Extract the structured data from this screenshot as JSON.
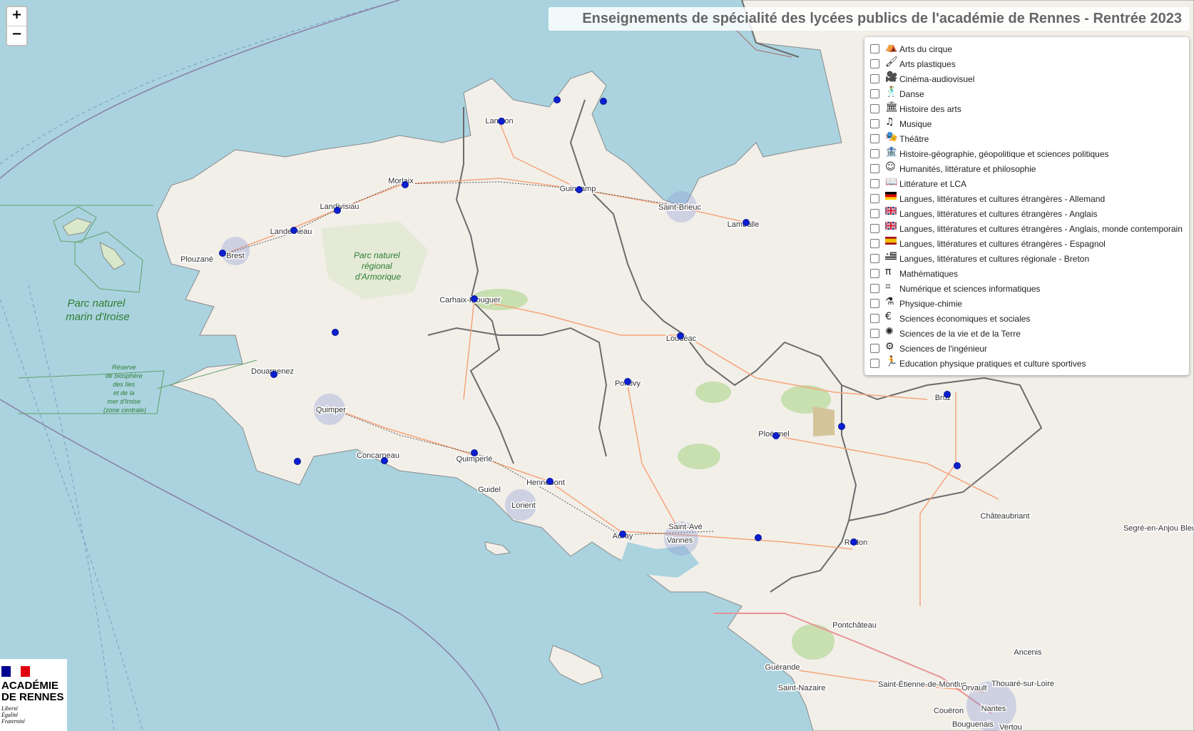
{
  "title": "Enseignements de spécialité des lycées publics de l'académie de Rennes - Rentrée 2023",
  "zoom": {
    "in": "+",
    "out": "−"
  },
  "colors": {
    "sea": "#aad3df",
    "land": "#f2efe9",
    "marker": "#0b1fd1",
    "boundary": "#6b6b6b"
  },
  "legend": [
    {
      "label": "Arts du cirque",
      "icon": "circus-tent-icon",
      "checked": false
    },
    {
      "label": "Arts plastiques",
      "icon": "paintbrush-icon",
      "checked": false
    },
    {
      "label": "Cinéma-audiovisuel",
      "icon": "video-camera-icon",
      "checked": false
    },
    {
      "label": "Danse",
      "icon": "dancer-icon",
      "checked": false
    },
    {
      "label": "Histoire des arts",
      "icon": "column-icon",
      "checked": false
    },
    {
      "label": "Musique",
      "icon": "music-note-icon",
      "checked": false
    },
    {
      "label": "Théâtre",
      "icon": "theater-curtain-icon",
      "checked": false
    },
    {
      "label": "Histoire-géographie, géopolitique et sciences politiques",
      "icon": "landmark-icon",
      "checked": false
    },
    {
      "label": "Humanités, littérature et philosophie",
      "icon": "head-profile-icon",
      "checked": false
    },
    {
      "label": "Littérature et LCA",
      "icon": "book-icon",
      "checked": false
    },
    {
      "label": "Langues, littératures et cultures étrangères - Allemand",
      "icon": "german-flag-icon",
      "checked": false
    },
    {
      "label": "Langues, littératures et cultures étrangères - Anglais",
      "icon": "uk-flag-icon",
      "checked": false
    },
    {
      "label": "Langues, littératures et cultures étrangères - Anglais, monde contemporain",
      "icon": "uk-flag-icon",
      "checked": false
    },
    {
      "label": "Langues, littératures et cultures étrangères - Espagnol",
      "icon": "spanish-flag-icon",
      "checked": false
    },
    {
      "label": "Langues, littératures et cultures régionale - Breton",
      "icon": "breton-flag-icon",
      "checked": false
    },
    {
      "label": "Mathématiques",
      "icon": "pi-icon",
      "checked": false
    },
    {
      "label": "Numérique et sciences informatiques",
      "icon": "binary-code-icon",
      "checked": false
    },
    {
      "label": "Physique-chimie",
      "icon": "flask-icon",
      "checked": false
    },
    {
      "label": "Sciences économiques et sociales",
      "icon": "euro-icon",
      "checked": false
    },
    {
      "label": "Sciences de la vie et de la Terre",
      "icon": "virus-icon",
      "checked": false
    },
    {
      "label": "Sciences de l'ingénieur",
      "icon": "gear-robot-icon",
      "checked": false
    },
    {
      "label": "Education physique pratiques et culture sportives",
      "icon": "runner-icon",
      "checked": false
    }
  ],
  "places": [
    "Lannion",
    "Morlaix",
    "Guingamp",
    "Saint-Brieuc",
    "Lamballe",
    "Landivisiau",
    "Landerneau",
    "Plouzané",
    "Brest",
    "Carhaix-Plouguer",
    "Loudéac",
    "Douarnenez",
    "Quimper",
    "Concarneau",
    "Quimperlé",
    "Pontivy",
    "Ploërmel",
    "Bruz",
    "Guidel",
    "Hennebont",
    "Lorient",
    "Auray",
    "Saint-Avé",
    "Vannes",
    "Redon",
    "Châteaubriant",
    "Segré-en-Anjou Bleu",
    "Pontchâteau",
    "Guérande",
    "Saint-Nazaire",
    "Saint-Étienne-de-Montluc",
    "Orvault",
    "Thouaré-sur-Loire",
    "Nantes",
    "Ancenis",
    "Couëron",
    "Bouguenais",
    "Vertou"
  ],
  "parks": {
    "armorique": [
      "Parc naturel",
      "régional",
      "d'Armorique"
    ],
    "iroise": [
      "Parc naturel",
      "marin d'Iroise"
    ],
    "biosphere": [
      "Réserve",
      "de biosphère",
      "des îles",
      "et de la",
      "mer d'Iroise",
      "(zone centrale)"
    ]
  },
  "logo": {
    "name": [
      "ACADÉMIE",
      "DE RENNES"
    ],
    "motto": [
      "Liberté",
      "Égalité",
      "Fraternité"
    ]
  }
}
